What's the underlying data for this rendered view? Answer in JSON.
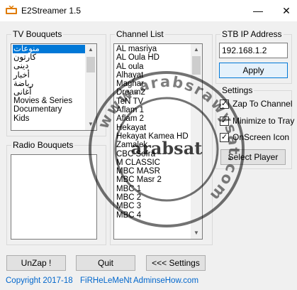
{
  "window": {
    "title": "E2Streamer 1.5",
    "minimize_glyph": "—",
    "close_glyph": "✕"
  },
  "tv_bouquets": {
    "label": "TV Bouquets",
    "items": [
      "منوعات",
      "كارتون",
      "دينى",
      "أخبار",
      "رياضة",
      "أغانى",
      "Movies & Series",
      "Documentary",
      "Kids"
    ],
    "selected_index": 0
  },
  "radio_bouquets": {
    "label": "Radio Bouquets",
    "items": []
  },
  "channel_list": {
    "label": "Channel List",
    "items": [
      "AL masriya",
      "AL Oula HD",
      "AL oula",
      "Alhayat",
      "Maghar",
      "Dream2",
      "TeN TV",
      "Aflam 1",
      "Aflam 2",
      "Hekayat",
      "Hekayat Kamea HD",
      "Zamalek",
      "CBC Sofra",
      "M CLASSIC",
      "MBC MASR",
      "MBC Masr 2",
      "MBC 1",
      "MBC 2",
      "MBC 3",
      "MBC 4"
    ]
  },
  "stb": {
    "label": "STB IP Address",
    "ip_value": "192.168.1.2",
    "apply_label": "Apply"
  },
  "settings": {
    "label": "Settings",
    "zap_to_channel": {
      "label": "Zap To Channel",
      "checked": true
    },
    "minimize_to_tray": {
      "label": "Minimize to Tray",
      "checked": true
    },
    "onscreen_icon": {
      "label": "OnScreen Icon",
      "checked": true
    },
    "select_player_label": "Select Player"
  },
  "bottom_bar": {
    "unzap_label": "UnZap !",
    "quit_label": "Quit",
    "settings_label": "<<< Settings"
  },
  "footer": {
    "copyright": "Copyright 2017-18",
    "author": "FiRHeLeMeNt",
    "site": "AdminseHow.com"
  },
  "watermark": {
    "ring_text": "www.arabsrawysat.com",
    "center_text": "arabsat"
  },
  "colors": {
    "selection": "#0078d7",
    "link": "#0066cc",
    "window_bg": "#f0f0f0"
  }
}
